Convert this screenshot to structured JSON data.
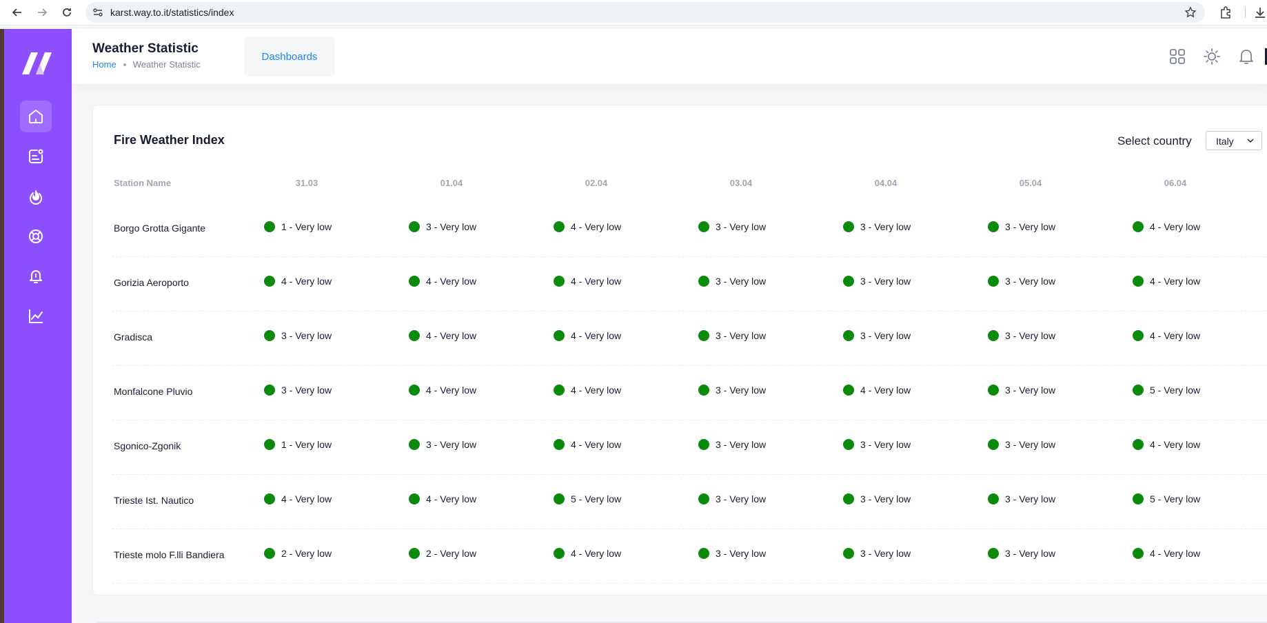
{
  "browser": {
    "url": "karst.way.to.it/statistics/index",
    "icons": [
      "back-arrow-icon",
      "forward-arrow-icon",
      "reload-icon",
      "site-info-icon",
      "star-icon",
      "extensions-icon",
      "download-icon"
    ]
  },
  "sidebar": {
    "logo": "app-logo",
    "items": [
      {
        "icon": "home-icon",
        "active": true
      },
      {
        "icon": "notification-board-icon",
        "active": false
      },
      {
        "icon": "fire-icon",
        "active": false
      },
      {
        "icon": "lifebuoy-icon",
        "active": false
      },
      {
        "icon": "bell-icon",
        "active": false
      },
      {
        "icon": "chart-line-icon",
        "active": false
      }
    ],
    "color": "#8e4fff"
  },
  "header": {
    "title": "Weather Statistic",
    "breadcrumb": {
      "home": "Home",
      "current": "Weather Statistic"
    },
    "dashboards_label": "Dashboards",
    "icons": [
      "grid-icon",
      "sun-icon",
      "bell-icon"
    ]
  },
  "card": {
    "title": "Fire Weather Index",
    "select_label": "Select country",
    "country": "Italy",
    "columns": [
      "Station Name",
      "31.03",
      "01.04",
      "02.04",
      "03.04",
      "04.04",
      "05.04",
      "06.04"
    ],
    "rows": [
      {
        "station": "Borgo Grotta Gigante",
        "values": [
          "1 - Very low",
          "3 - Very low",
          "4 - Very low",
          "3 - Very low",
          "3 - Very low",
          "3 - Very low",
          "4 - Very low"
        ]
      },
      {
        "station": "Gorizia Aeroporto",
        "values": [
          "4 - Very low",
          "4 - Very low",
          "4 - Very low",
          "3 - Very low",
          "3 - Very low",
          "3 - Very low",
          "4 - Very low"
        ]
      },
      {
        "station": "Gradisca",
        "values": [
          "3 - Very low",
          "4 - Very low",
          "4 - Very low",
          "3 - Very low",
          "3 - Very low",
          "3 - Very low",
          "4 - Very low"
        ]
      },
      {
        "station": "Monfalcone Pluvio",
        "values": [
          "3 - Very low",
          "4 - Very low",
          "4 - Very low",
          "3 - Very low",
          "4 - Very low",
          "3 - Very low",
          "5 - Very low"
        ]
      },
      {
        "station": "Sgonico-Zgonik",
        "values": [
          "1 - Very low",
          "3 - Very low",
          "4 - Very low",
          "3 - Very low",
          "3 - Very low",
          "3 - Very low",
          "4 - Very low"
        ]
      },
      {
        "station": "Trieste Ist. Nautico",
        "values": [
          "4 - Very low",
          "4 - Very low",
          "5 - Very low",
          "3 - Very low",
          "3 - Very low",
          "3 - Very low",
          "5 - Very low"
        ]
      },
      {
        "station": "Trieste molo F.lli Bandiera",
        "values": [
          "2 - Very low",
          "2 - Very low",
          "4 - Very low",
          "3 - Very low",
          "3 - Very low",
          "3 - Very low",
          "4 - Very low"
        ]
      }
    ],
    "status_color": "#0b8a0b"
  }
}
